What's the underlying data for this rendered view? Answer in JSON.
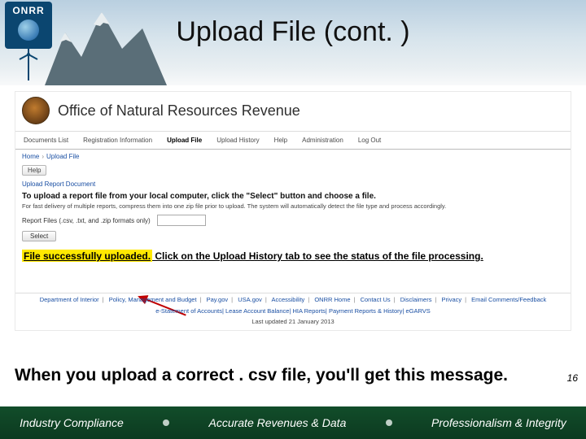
{
  "slide": {
    "title": "Upload File (cont. )",
    "page_number": "16"
  },
  "logo": {
    "text": "ONRR"
  },
  "app": {
    "title": "Office of Natural Resources Revenue"
  },
  "tabs": [
    "Documents List",
    "Registration Information",
    "Upload File",
    "Upload History",
    "Help",
    "Administration",
    "Log Out"
  ],
  "active_tab_index": 2,
  "breadcrumb": {
    "home": "Home",
    "current": "Upload File"
  },
  "buttons": {
    "help": "Help",
    "select": "Select"
  },
  "section_link": "Upload Report Document",
  "instructions": {
    "main": "To upload a report file from your local computer, click the \"Select\" button and choose a file.",
    "sub": "For fast delivery of multiple reports, compress them into one zip file prior to upload. The system will automatically detect the file type and process accordingly.",
    "report_label": "Report Files (.csv, .txt, and .zip formats only)"
  },
  "message": {
    "highlight": "File successfully uploaded.",
    "rest": " Click on the Upload History tab to see the status of the file processing."
  },
  "footer": {
    "row1": [
      "Department of Interior",
      "Policy, Management and Budget",
      "Pay.gov",
      "USA.gov",
      "Accessibility",
      "ONRR Home",
      "Contact Us",
      "Disclaimers",
      "Privacy",
      "Email Comments/Feedback"
    ],
    "row2": [
      "e-Statement of Accounts",
      "Lease Account Balance",
      "HIA Reports",
      "Payment Reports & History",
      "eGARVS"
    ],
    "updated": "Last updated 21 January 2013"
  },
  "caption": "When you upload a correct . csv file, you'll get this message.",
  "bottom_bar": {
    "a": "Industry Compliance",
    "b": "Accurate Revenues & Data",
    "c": "Professionalism & Integrity"
  }
}
